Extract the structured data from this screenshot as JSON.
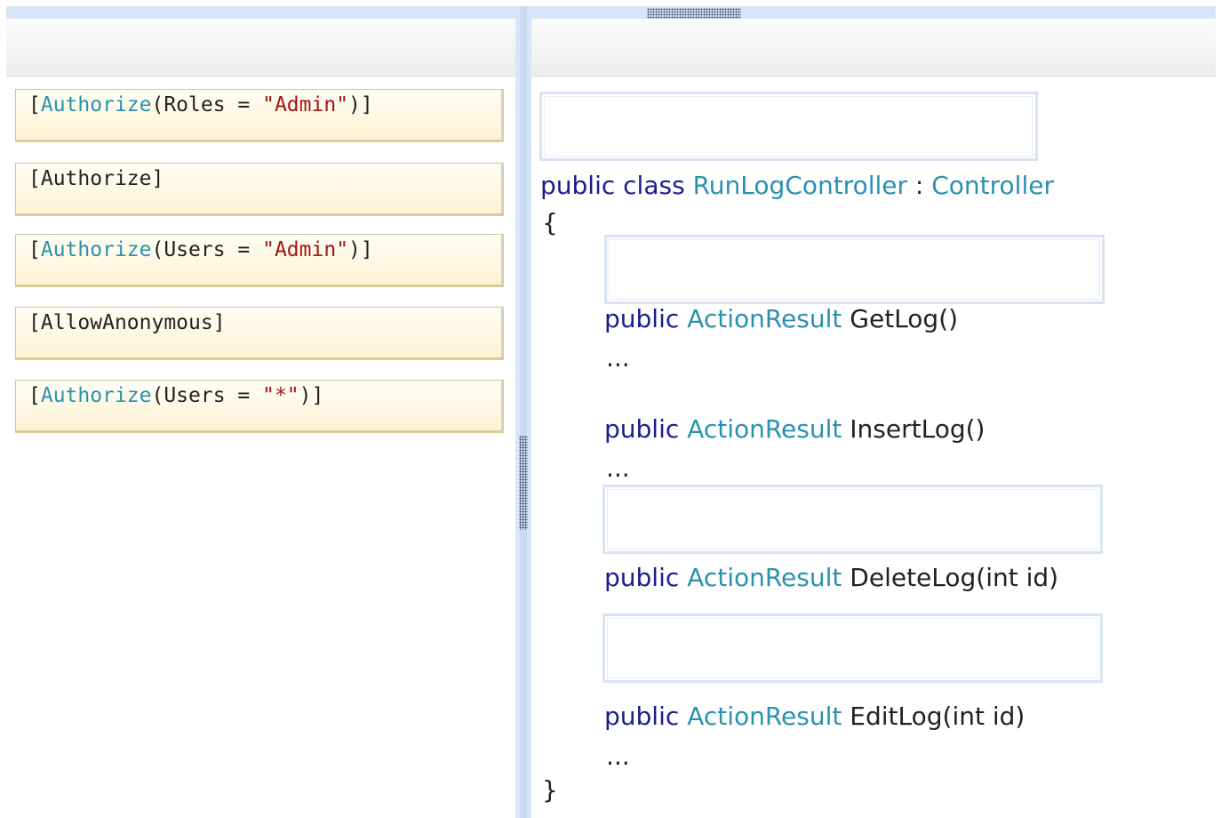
{
  "options": [
    {
      "open": "[",
      "attr": "Authorize",
      "args": "(Roles = ",
      "value": "\"Admin\"",
      "close": ")]"
    },
    {
      "open": "[",
      "attr": "Authorize",
      "args": "",
      "value": "",
      "close": "]"
    },
    {
      "open": "[",
      "attr": "Authorize",
      "args": "(Users = ",
      "value": "\"Admin\"",
      "close": ")]"
    },
    {
      "open": "[",
      "attr": "AllowAnonymous",
      "args": "",
      "value": "",
      "close": "]"
    },
    {
      "open": "[",
      "attr": "Authorize",
      "args": "(Users = ",
      "value": "\"*\"",
      "close": ")]"
    }
  ],
  "code": {
    "class_decl": {
      "kw1": "public",
      "kw2": "class",
      "name": "RunLogController",
      "colon": " : ",
      "base": "Controller"
    },
    "open_brace": "{",
    "close_brace": "}",
    "methods": [
      {
        "kw": "public",
        "type": "ActionResult",
        "sig": "GetLog()",
        "body": "..."
      },
      {
        "kw": "public",
        "type": "ActionResult",
        "sig": "InsertLog()",
        "body": "..."
      },
      {
        "kw": "public",
        "type": "ActionResult",
        "sig": "DeleteLog(int id)",
        "body": ""
      },
      {
        "kw": "public",
        "type": "ActionResult",
        "sig": "EditLog(int id)",
        "body": "..."
      }
    ]
  }
}
